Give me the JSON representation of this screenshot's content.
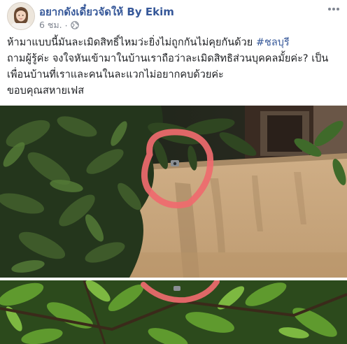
{
  "post": {
    "page_name": "อยากดังเดี๋ยวจัดให้ By Ekim",
    "time": "6 ชม.",
    "separator": "·",
    "privacy_icon": "globe-icon",
    "more_icon": "more-horizontal-icon",
    "text_line1_main": "ห้ามาแบบนี้มันละเมิดสิทธิ์ไหมว่ะยิ่งไม่ถูกกันไม่คุยกันด้วย ",
    "text_line1_hashtag": "#ชลบุรี",
    "text_line2": "ถามผู้รู้ค่ะ จงใจหันเข้ามาในบ้านเราถือว่าละเมิดสิทธิส่วนบุคคลมั้ยค่ะ? เป็น",
    "text_line3": "เพื่อนบ้านที่เราและคนในละแวกไม่อยากคบด้วยค่ะ",
    "text_line4": "ขอบคุณสหายเฟส"
  },
  "colors": {
    "link": "#365899",
    "meta": "#7f8590",
    "highlight_circle": "#ef6a6e"
  }
}
